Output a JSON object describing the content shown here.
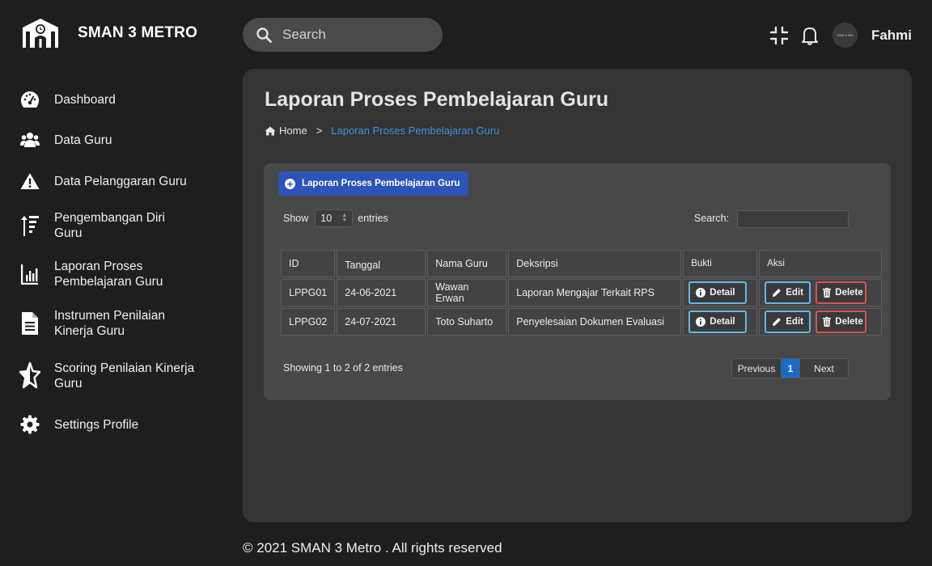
{
  "brand": {
    "name": "SMAN 3 METRO"
  },
  "sidebar": {
    "items": [
      {
        "label": "Dashboard",
        "icon": "dashboard-gauge-icon"
      },
      {
        "label": "Data Guru",
        "icon": "users-icon"
      },
      {
        "label": "Data Pelanggaran Guru",
        "icon": "warning-icon"
      },
      {
        "label": "Pengembangan Diri Guru",
        "icon": "sort-amount-up-icon"
      },
      {
        "label": "Laporan Proses Pembelajaran Guru",
        "icon": "bar-chart-icon"
      },
      {
        "label": "Instrumen Penilaian Kinerja Guru",
        "icon": "document-icon"
      },
      {
        "label": "Scoring Penilaian Kinerja Guru",
        "icon": "star-half-icon"
      },
      {
        "label": "Settings Profile",
        "icon": "gear-icon"
      }
    ]
  },
  "topbar": {
    "search_placeholder": "Search",
    "avatar_text": "1200 X 900",
    "username": "Fahmi"
  },
  "main": {
    "title": "Laporan Proses Pembelajaran Guru",
    "breadcrumb": {
      "home": "Home",
      "separator": ">",
      "current": "Laporan Proses Pembelajaran Guru"
    },
    "add_button": "Laporan Proses Pembelajaran Guru",
    "show_label": "Show",
    "show_value": "10",
    "entries_label": "entries",
    "search_label": "Search:",
    "table": {
      "headers": [
        "ID",
        "Tanggal",
        "Nama Guru",
        "Deksripsi",
        "Bukti",
        "Aksi"
      ],
      "rows": [
        {
          "id": "LPPG01",
          "tanggal": "24-06-2021",
          "nama": "Wawan Erwan",
          "deskripsi": "Laporan Mengajar Terkait RPS"
        },
        {
          "id": "LPPG02",
          "tanggal": "24-07-2021",
          "nama": "Toto Suharto",
          "deskripsi": "Penyelesaian Dokumen Evaluasi"
        }
      ],
      "detail_label": "Detail",
      "edit_label": "Edit",
      "delete_label": "Delete"
    },
    "showing_text": "Showing 1 to 2 of 2 entries",
    "pagination": {
      "previous": "Previous",
      "page": "1",
      "next": "Next"
    }
  },
  "footer": {
    "text": "© 2021 SMAN 3 Metro . All rights reserved"
  },
  "colors": {
    "accent": "#2b53b8",
    "link": "#3d95e6",
    "info_border": "#64b8e8",
    "danger_border": "#d9534f",
    "page_active": "#1b6ac9"
  }
}
